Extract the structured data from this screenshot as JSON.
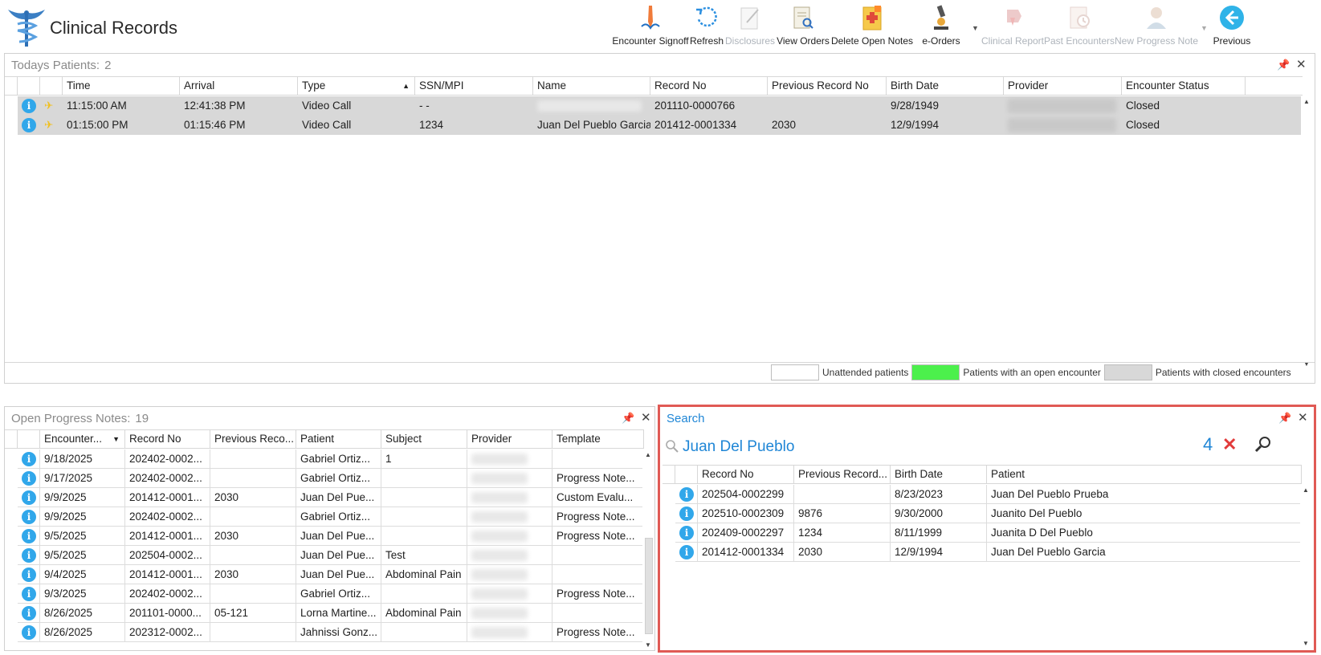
{
  "app": {
    "title": "Clinical Records"
  },
  "toolbar": {
    "buttons": [
      {
        "label": "Encounter Signoff",
        "icon": "signoff-pen-icon",
        "enabled": true
      },
      {
        "label": "Refresh",
        "icon": "refresh-icon",
        "enabled": true
      },
      {
        "label": "Disclosures",
        "icon": "disclosures-icon",
        "enabled": false
      },
      {
        "label": "View Orders",
        "icon": "view-orders-icon",
        "enabled": true
      },
      {
        "label": "Delete Open Notes",
        "icon": "delete-notes-icon",
        "enabled": true
      },
      {
        "label": "e-Orders",
        "icon": "microscope-icon",
        "enabled": true
      },
      {
        "label": "Clinical Report",
        "icon": "clinical-report-icon",
        "enabled": false
      },
      {
        "label": "Past Encounters",
        "icon": "past-encounters-icon",
        "enabled": false
      },
      {
        "label": "New Progress Note",
        "icon": "new-progress-note-icon",
        "enabled": false
      },
      {
        "label": "Previous",
        "icon": "back-arrow-icon",
        "enabled": true
      }
    ]
  },
  "todays_patients": {
    "title": "Todays Patients:",
    "count": "2",
    "columns": [
      "Time",
      "Arrival",
      "Type",
      "SSN/MPI",
      "Name",
      "Record No",
      "Previous Record No",
      "Birth Date",
      "Provider",
      "Encounter Status"
    ],
    "rows": [
      {
        "time": "11:15:00 AM",
        "arrival": "12:41:38 PM",
        "type": "Video Call",
        "ssn": "-  -",
        "name": "",
        "record_no": "201110-0000766",
        "prev_record": "",
        "birth_date": "9/28/1949",
        "status": "Closed"
      },
      {
        "time": "01:15:00 PM",
        "arrival": "01:15:46 PM",
        "type": "Video Call",
        "ssn": "1234",
        "name": "Juan Del Pueblo Garcia",
        "record_no": "201412-0001334",
        "prev_record": "2030",
        "birth_date": "12/9/1994",
        "status": "Closed"
      }
    ]
  },
  "legend": {
    "unattended": "Unattended patients",
    "open": "Patients with an open encounter",
    "closed": "Patients with closed encounters",
    "colors": {
      "unattended": "#ffffff",
      "open": "#4cf04c",
      "closed": "#d8d8d8"
    }
  },
  "open_notes": {
    "title": "Open Progress Notes:",
    "count": "19",
    "columns": [
      "Encounter...",
      "Record No",
      "Previous Reco...",
      "Patient",
      "Subject",
      "Provider",
      "Template"
    ],
    "rows": [
      {
        "date": "9/18/2025",
        "record": "202402-0002...",
        "prev": "",
        "patient": "Gabriel Ortiz...",
        "subject": "1",
        "template": ""
      },
      {
        "date": "9/17/2025",
        "record": "202402-0002...",
        "prev": "",
        "patient": "Gabriel Ortiz...",
        "subject": "",
        "template": "Progress Note..."
      },
      {
        "date": "9/9/2025",
        "record": "201412-0001...",
        "prev": "2030",
        "patient": "Juan Del Pue...",
        "subject": "",
        "template": "Custom Evalu..."
      },
      {
        "date": "9/9/2025",
        "record": "202402-0002...",
        "prev": "",
        "patient": "Gabriel Ortiz...",
        "subject": "",
        "template": "Progress Note..."
      },
      {
        "date": "9/5/2025",
        "record": "201412-0001...",
        "prev": "2030",
        "patient": "Juan Del Pue...",
        "subject": "",
        "template": "Progress Note..."
      },
      {
        "date": "9/5/2025",
        "record": "202504-0002...",
        "prev": "",
        "patient": "Juan Del Pue...",
        "subject": "Test",
        "template": ""
      },
      {
        "date": "9/4/2025",
        "record": "201412-0001...",
        "prev": "2030",
        "patient": "Juan Del Pue...",
        "subject": "Abdominal Pain",
        "template": ""
      },
      {
        "date": "9/3/2025",
        "record": "202402-0002...",
        "prev": "",
        "patient": "Gabriel Ortiz...",
        "subject": "",
        "template": "Progress Note..."
      },
      {
        "date": "8/26/2025",
        "record": "201101-0000...",
        "prev": "05-121",
        "patient": "Lorna Martine...",
        "subject": "Abdominal Pain",
        "template": ""
      },
      {
        "date": "8/26/2025",
        "record": "202312-0002...",
        "prev": "",
        "patient": "Jahnissi Gonz...",
        "subject": "",
        "template": "Progress Note..."
      }
    ]
  },
  "search": {
    "title": "Search",
    "query": "Juan Del Pueblo",
    "result_count": "4",
    "columns": [
      "Record No",
      "Previous Record...",
      "Birth Date",
      "Patient"
    ],
    "rows": [
      {
        "record": "202504-0002299",
        "prev": "",
        "birth": "8/23/2023",
        "patient": "Juan Del Pueblo Prueba"
      },
      {
        "record": "202510-0002309",
        "prev": "9876",
        "birth": "9/30/2000",
        "patient": "Juanito Del Pueblo"
      },
      {
        "record": "202409-0002297",
        "prev": "1234",
        "birth": "8/11/1999",
        "patient": "Juanita D Del Pueblo"
      },
      {
        "record": "201412-0001334",
        "prev": "2030",
        "birth": "12/9/1994",
        "patient": "Juan Del Pueblo Garcia"
      }
    ]
  }
}
